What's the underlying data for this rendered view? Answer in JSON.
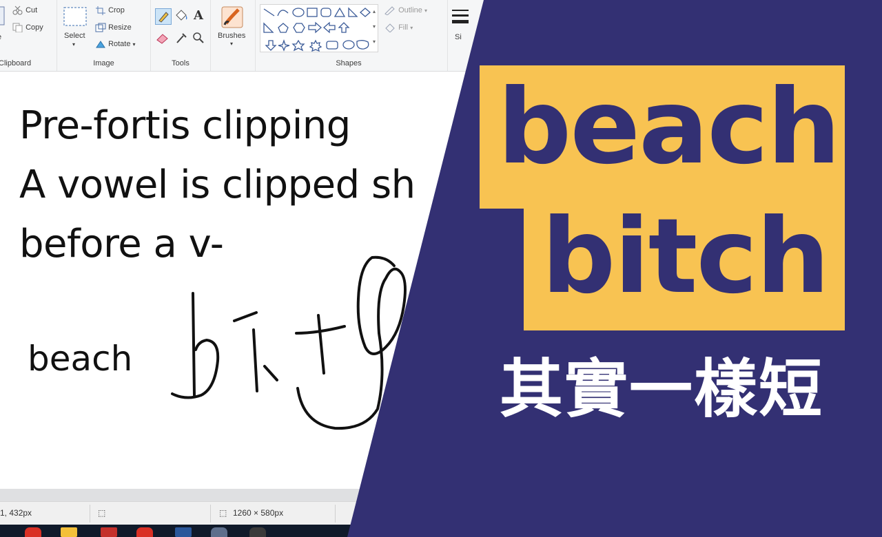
{
  "ribbon": {
    "clipboard": {
      "label": "Clipboard",
      "paste_label": "e",
      "cut_label": "Cut",
      "copy_label": "Copy"
    },
    "image": {
      "label": "Image",
      "select_label": "Select",
      "crop_label": "Crop",
      "resize_label": "Resize",
      "rotate_label": "Rotate"
    },
    "tools": {
      "label": "Tools"
    },
    "brushes": {
      "label": "Brushes"
    },
    "shapes": {
      "label": "Shapes",
      "outline_label": "Outline",
      "fill_label": "Fill"
    },
    "size": {
      "label": "Si"
    }
  },
  "canvas": {
    "lines": [
      "Pre-fortis clipping",
      "A vowel is clipped sh",
      "before a v-"
    ],
    "word": "beach"
  },
  "status": {
    "cursor_pos": "1, 432px",
    "image_size": "1260 × 580px"
  },
  "banner": {
    "word1": "beach",
    "word2": "bitch",
    "caption": "其實一樣短",
    "colors": {
      "navy": "#333073",
      "yellow": "#f8c352",
      "white": "#ffffff"
    }
  }
}
